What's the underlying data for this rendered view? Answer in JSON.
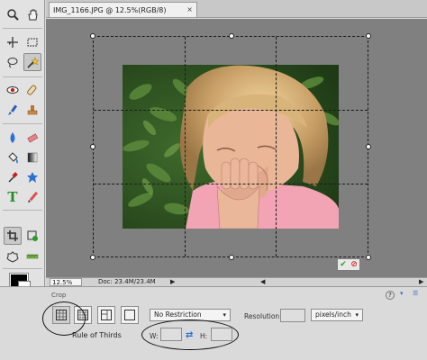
{
  "document": {
    "tab_title": "IMG_1166.JPG @ 12.5%(RGB/8)",
    "close_glyph": "×"
  },
  "toolbar": {
    "tools": [
      {
        "name": "zoom-icon",
        "selected": false
      },
      {
        "name": "hand-icon",
        "selected": false
      },
      {
        "name": "move-icon",
        "selected": false
      },
      {
        "name": "rectangular-marquee-icon",
        "selected": false
      },
      {
        "name": "lasso-icon",
        "selected": false
      },
      {
        "name": "quick-selection-icon",
        "selected": true
      },
      {
        "name": "red-eye-icon",
        "selected": false
      },
      {
        "name": "spot-healing-icon",
        "selected": false
      },
      {
        "name": "smart-brush-icon",
        "selected": false
      },
      {
        "name": "clone-stamp-icon",
        "selected": false
      },
      {
        "name": "blur-icon",
        "selected": false
      },
      {
        "name": "eraser-icon",
        "selected": false
      },
      {
        "name": "paint-bucket-icon",
        "selected": false
      },
      {
        "name": "gradient-icon",
        "selected": false
      },
      {
        "name": "eyedropper-icon",
        "selected": false
      },
      {
        "name": "custom-shape-icon",
        "selected": false
      },
      {
        "name": "type-icon",
        "selected": false
      },
      {
        "name": "pencil-icon",
        "selected": false
      },
      {
        "name": "crop-icon",
        "selected": true
      },
      {
        "name": "recompose-icon",
        "selected": false
      },
      {
        "name": "cookie-cutter-icon",
        "selected": false
      },
      {
        "name": "straighten-icon",
        "selected": false
      }
    ],
    "foreground_color": "#000000",
    "background_color": "#ffffff"
  },
  "status": {
    "zoom": "12.5%",
    "doc_size": "Doc: 23.4M/23.4M",
    "arrow": "▶",
    "scroll_left": "◀",
    "scroll_right": "▶"
  },
  "options": {
    "section_title": "Crop",
    "overlay_label": "Rule of Thirds",
    "aspect_ratio": "No Restriction",
    "resolution_label": "Resolution:",
    "resolution_value": "",
    "resolution_unit": "pixels/inch",
    "width_label": "W:",
    "width_value": "",
    "height_label": "H:",
    "height_value": "",
    "help_glyph": "?",
    "dropdown_glyph": "▾"
  },
  "colors": {
    "canvas": "#808080",
    "accent": "#1f6fd0",
    "commit_green": "#2ea02e",
    "cancel_red": "#d03030"
  }
}
